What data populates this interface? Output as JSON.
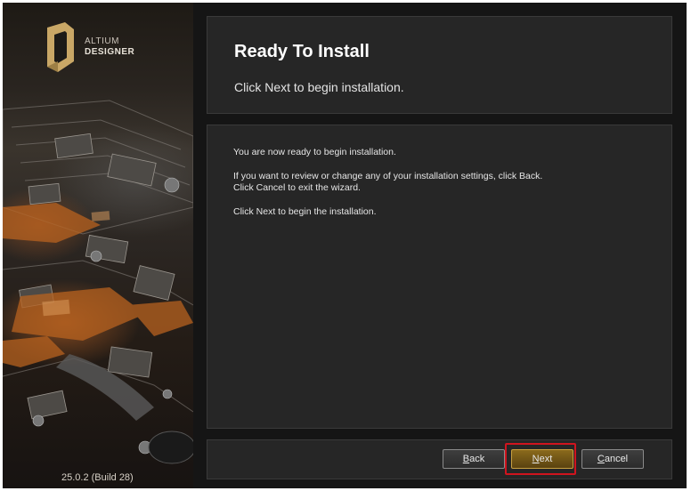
{
  "brand": {
    "line1": "ALTIUM",
    "line2": "DESIGNER",
    "logo_icon": "altium-logo-icon"
  },
  "version": "25.0.2 (Build 28)",
  "header": {
    "title": "Ready To Install",
    "subtitle": "Click Next to begin installation."
  },
  "body": {
    "line1": "You are now ready to begin installation.",
    "line2": "If you want to review or change any of your installation settings, click Back.",
    "line3": "Click Cancel to exit the wizard.",
    "line4": "Click Next to begin the installation."
  },
  "buttons": {
    "back": {
      "mnemonic": "B",
      "rest": "ack"
    },
    "next": {
      "mnemonic": "N",
      "rest": "ext"
    },
    "cancel": {
      "mnemonic": "C",
      "rest": "ancel"
    }
  },
  "colors": {
    "background": "#151515",
    "panel": "#262626",
    "accent": "#c8a040",
    "highlight": "#d0141e"
  }
}
